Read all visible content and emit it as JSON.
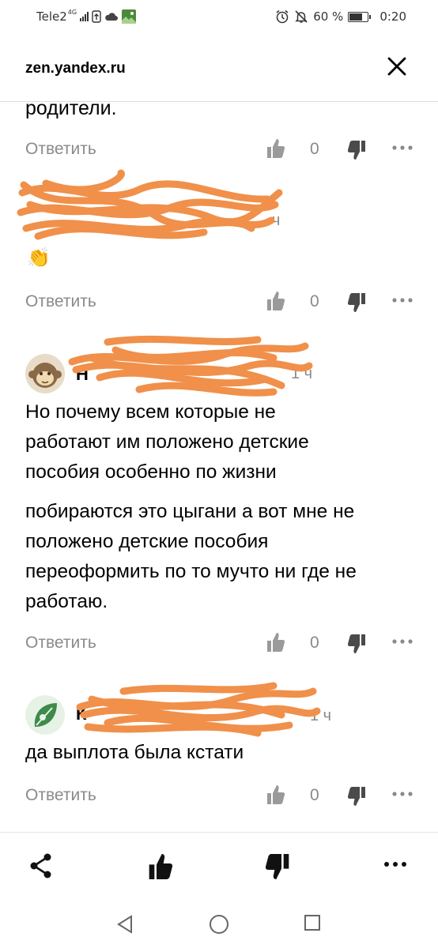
{
  "status_bar": {
    "carrier": "Tele2",
    "network": "4G",
    "battery_percent": "60 %",
    "time": "0:20"
  },
  "browser": {
    "domain": "zen.yandex.ru"
  },
  "comments": [
    {
      "text_lines": [
        "родители."
      ],
      "reply_label": "Ответить",
      "likes": "0"
    },
    {
      "time": "ч",
      "emoji": "👏",
      "reply_label": "Ответить",
      "likes": "0"
    },
    {
      "author_initial": "Н",
      "time": "1 ч",
      "text_lines": [
        "Но почему всем которые не",
        "работают им положено детские",
        "пособия особенно по жизни",
        "побираются это цыгани а вот мне не",
        "положено детские пособия",
        "переоформить по то мучто ни где не",
        "работаю."
      ],
      "reply_label": "Ответить",
      "likes": "0"
    },
    {
      "author_initial": "К",
      "time": "1 ч",
      "text_lines": [
        "да выплота была кстати"
      ],
      "reply_label": "Ответить",
      "likes": "0"
    }
  ],
  "bottom_bar": {
    "icons": [
      "share-icon",
      "thumbs-up-icon",
      "thumbs-down-icon",
      "more-icon"
    ]
  },
  "colors": {
    "scribble": "#f0904a",
    "secondary_text": "#8a8a8a"
  }
}
